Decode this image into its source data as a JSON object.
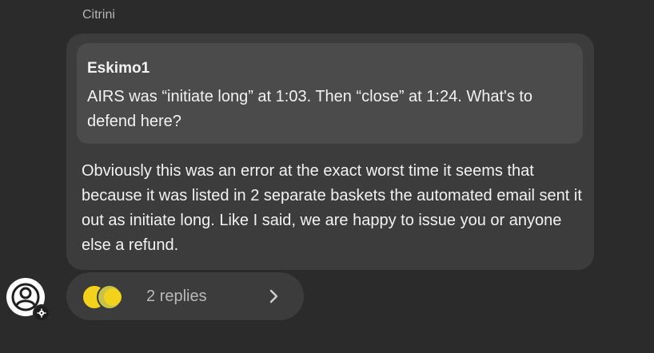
{
  "message": {
    "sender_name": "Citrini",
    "quote": {
      "author": "Eskimo1",
      "text": "AIRS was “initiate long” at 1:03. Then “close” at 1:24. What's to defend here?"
    },
    "body": "Obviously this was an error at the exact worst time it seems that because it was listed in 2 separate baskets the automated email sent it out as initiate long. Like I said, we are happy to issue you or anyone else a refund."
  },
  "thread": {
    "replies_label": "2 replies",
    "reply_avatar_icon": "user-avatar-icon",
    "chevron_icon": "chevron-right-icon"
  },
  "avatar": {
    "icon": "user-avatar-icon",
    "badge_icon": "gear-icon"
  },
  "colors": {
    "background": "#2b2b2b",
    "bubble": "#3c3c3c",
    "quote_bubble": "#4b4b4b",
    "reply_avatar_yellow": "#f2d21a",
    "reply_avatar_olive": "#c7c24a"
  }
}
